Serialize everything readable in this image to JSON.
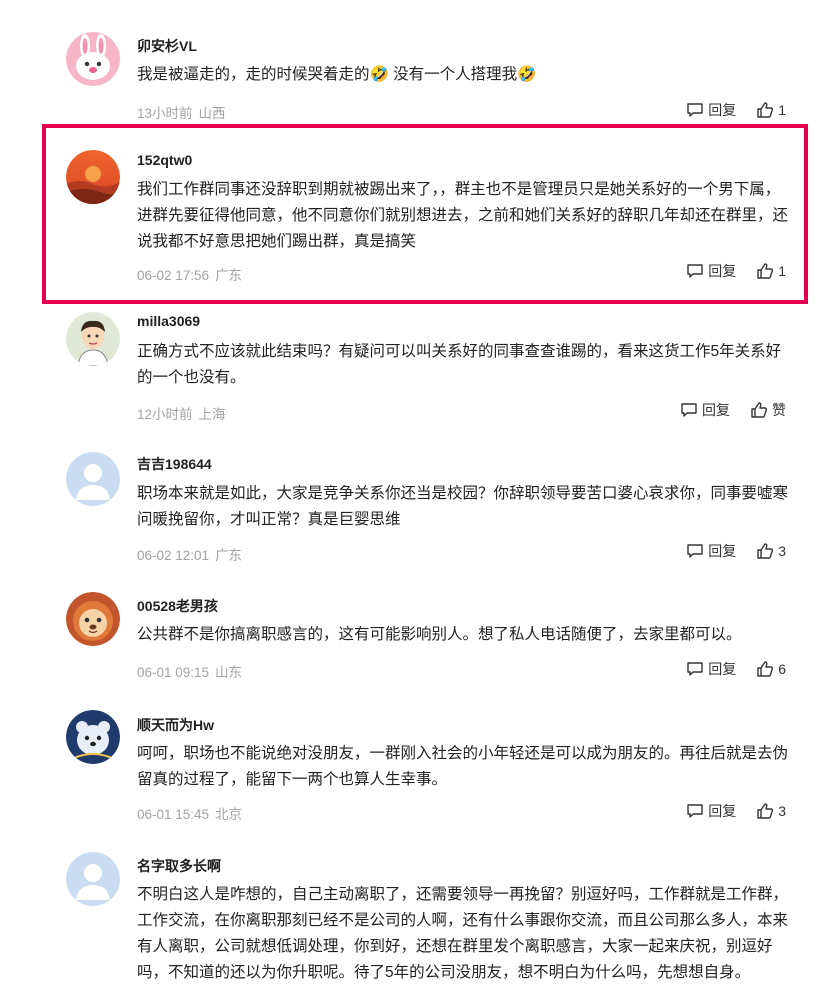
{
  "comments": [
    {
      "user": "卯安杉VL",
      "text": "我是被逼走的，走的时候哭着走的🤣 没有一个人搭理我🤣",
      "time": "13小时前",
      "location": "山西",
      "reply": "回复",
      "likes": "1",
      "avatar": "rabbit-avatar"
    },
    {
      "user": "152qtw0",
      "text": "我们工作群同事还没辞职到期就被踢出来了，，群主也不是管理员只是她关系好的一个男下属，进群先要征得他同意，他不同意你们就别想进去，之前和她们关系好的辞职几年却还在群里，还说我都不好意思把她们踢出群，真是搞笑",
      "time": "06-02 17:56",
      "location": "广东",
      "reply": "回复",
      "likes": "1",
      "avatar": "sunset-avatar"
    },
    {
      "user": "milla3069",
      "text": "正确方式不应该就此结束吗？有疑问可以叫关系好的同事查查谁踢的，看来这货工作5年关系好的一个也没有。",
      "time": "12小时前",
      "location": "上海",
      "reply": "回复",
      "likes": "赞",
      "avatar": "cartoon-man-avatar"
    },
    {
      "user": "吉吉198644",
      "text": "职场本来就是如此，大家是竞争关系你还当是校园？你辞职领导要苦口婆心哀求你，同事要嘘寒问暖挽留你，才叫正常？真是巨婴思维",
      "time": "06-02 12:01",
      "location": "广东",
      "reply": "回复",
      "likes": "3",
      "avatar": "default-avatar"
    },
    {
      "user": "00528老男孩",
      "text": "公共群不是你搞离职感言的，这有可能影响别人。想了私人电话随便了，去家里都可以。",
      "time": "06-01 09:15",
      "location": "山东",
      "reply": "回复",
      "likes": "6",
      "avatar": "lion-avatar"
    },
    {
      "user": "顺天而为Hw",
      "text": "呵呵，职场也不能说绝对没朋友，一群刚入社会的小年轻还是可以成为朋友的。再往后就是去伪留真的过程了，能留下一两个也算人生幸事。",
      "time": "06-01 15:45",
      "location": "北京",
      "reply": "回复",
      "likes": "3",
      "avatar": "bear-avatar"
    },
    {
      "user": "名字取多长啊",
      "text": "不明白这人是咋想的，自己主动离职了，还需要领导一再挽留？别逗好吗，工作群就是工作群，工作交流，在你离职那刻已经不是公司的人啊，还有什么事跟你交流，而且公司那么多人，本来有人离职，公司就想低调处理，你到好，还想在群里发个离职感言，大家一起来庆祝，别逗好吗，不知道的还以为你升职呢。待了5年的公司没朋友，想不明白为什么吗，先想想自身。",
      "time": "",
      "location": "",
      "reply": "",
      "likes": "",
      "avatar": "default-avatar"
    }
  ],
  "colors": {
    "highlight": "#e0004d",
    "meta": "#a3a3a3"
  }
}
